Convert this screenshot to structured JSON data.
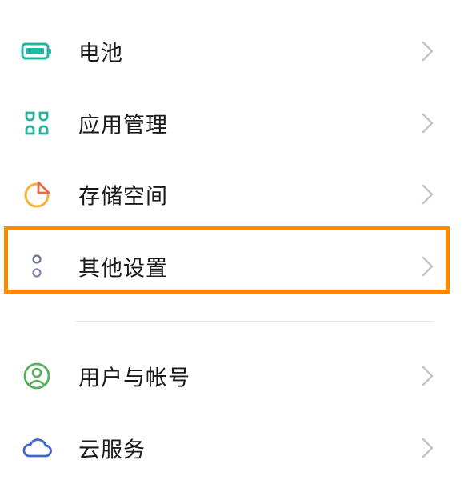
{
  "settings": {
    "items": [
      {
        "label": "电池",
        "icon": "battery-icon"
      },
      {
        "label": "应用管理",
        "icon": "app-management-icon"
      },
      {
        "label": "存储空间",
        "icon": "storage-icon"
      },
      {
        "label": "其他设置",
        "icon": "other-settings-icon"
      },
      {
        "label": "用户与帐号",
        "icon": "user-account-icon"
      },
      {
        "label": "云服务",
        "icon": "cloud-icon"
      }
    ]
  },
  "colors": {
    "battery": "#1fb8a3",
    "apps": "#26b5a0",
    "storage_ring": "#f2b233",
    "storage_slice": "#e86a4b",
    "other": "#6a7590",
    "user": "#56b05e",
    "cloud": "#3d68c8",
    "chevron": "#c4c4c4",
    "highlight": "#ff8a00"
  }
}
